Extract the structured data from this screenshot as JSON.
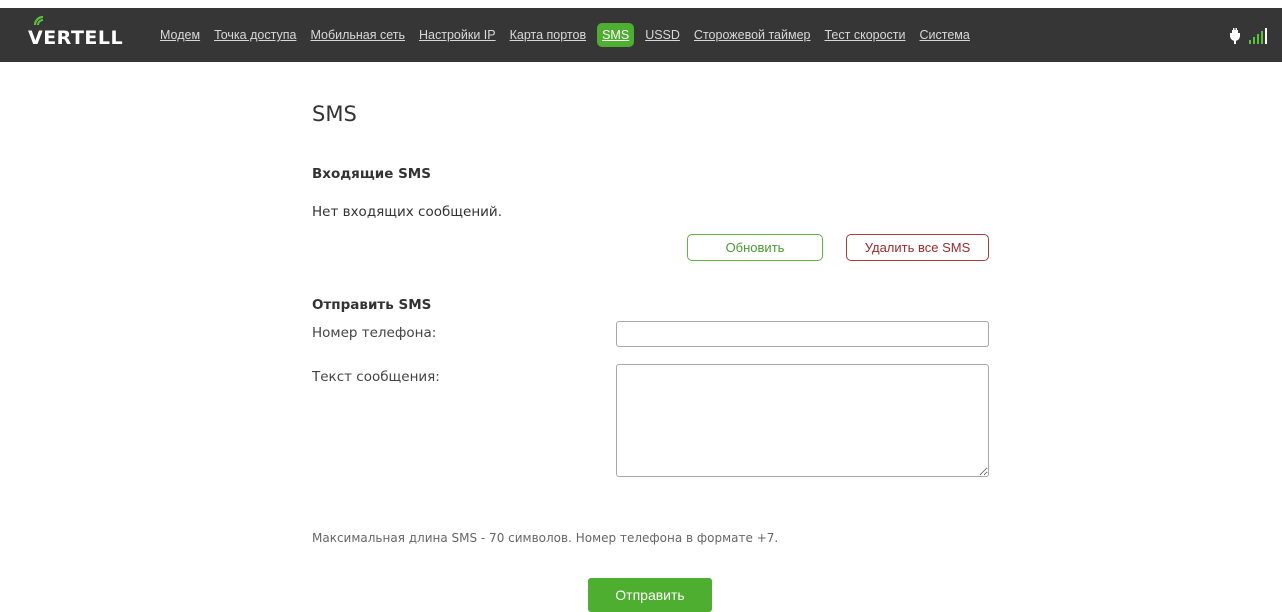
{
  "header": {
    "logo_text": "VERTELL",
    "nav": [
      {
        "label": "Модем",
        "active": false
      },
      {
        "label": "Точка доступа",
        "active": false
      },
      {
        "label": "Мобильная сеть",
        "active": false
      },
      {
        "label": "Настройки IP",
        "active": false
      },
      {
        "label": "Карта портов",
        "active": false
      },
      {
        "label": "SMS",
        "active": true
      },
      {
        "label": "USSD",
        "active": false
      },
      {
        "label": "Сторожевой таймер",
        "active": false
      },
      {
        "label": "Тест скорости",
        "active": false
      },
      {
        "label": "Система",
        "active": false
      }
    ],
    "status_icons": [
      "plug-icon",
      "signal-strength-icon"
    ],
    "signal_bars": 4
  },
  "main": {
    "title": "SMS",
    "inbox": {
      "title": "Входящие SMS",
      "empty_message": "Нет входящих сообщений.",
      "refresh_label": "Обновить",
      "delete_all_label": "Удалить все SMS"
    },
    "send": {
      "title": "Отправить SMS",
      "phone_label": "Номер телефона:",
      "phone_value": "",
      "text_label": "Текст сообщения:",
      "text_value": "",
      "hint": "Максимальная длина SMS - 70 символов. Номер телефона в формате +7.",
      "send_label": "Отправить"
    }
  },
  "colors": {
    "header_bg": "#363636",
    "accent_green": "#4dae30",
    "delete_red": "#b23a3a"
  }
}
